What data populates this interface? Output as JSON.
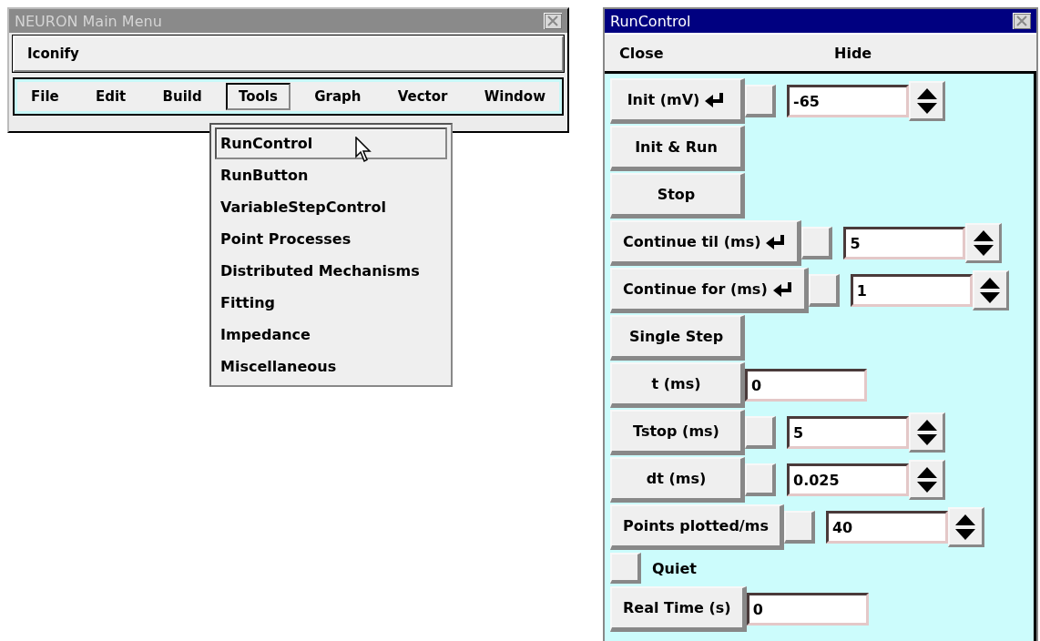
{
  "main_window": {
    "title": "NEURON Main Menu",
    "iconify": "Iconify",
    "menu": [
      {
        "label": "File",
        "selected": false
      },
      {
        "label": "Edit",
        "selected": false
      },
      {
        "label": "Build",
        "selected": false
      },
      {
        "label": "Tools",
        "selected": true
      },
      {
        "label": "Graph",
        "selected": false
      },
      {
        "label": "Vector",
        "selected": false
      },
      {
        "label": "Window",
        "selected": false
      }
    ]
  },
  "tools_menu": {
    "items": [
      {
        "label": "RunControl",
        "selected": true
      },
      {
        "label": "RunButton",
        "selected": false
      },
      {
        "label": "VariableStepControl",
        "selected": false
      },
      {
        "label": "Point Processes",
        "selected": false
      },
      {
        "label": "Distributed Mechanisms",
        "selected": false
      },
      {
        "label": "Fitting",
        "selected": false
      },
      {
        "label": "Impedance",
        "selected": false
      },
      {
        "label": "Miscellaneous",
        "selected": false
      }
    ]
  },
  "run_control": {
    "title": "RunControl",
    "header_buttons": [
      "Close",
      "Hide"
    ],
    "rows": [
      {
        "kind": "spinner",
        "label": "Init (mV)",
        "enter": true,
        "checked": false,
        "value": "-65"
      },
      {
        "kind": "button",
        "label": "Init & Run"
      },
      {
        "kind": "button",
        "label": "Stop"
      },
      {
        "kind": "spinner",
        "label": "Continue til (ms)",
        "enter": true,
        "checked": false,
        "value": "5"
      },
      {
        "kind": "spinner",
        "label": "Continue for (ms)",
        "enter": true,
        "checked": false,
        "value": "1"
      },
      {
        "kind": "button",
        "label": "Single Step"
      },
      {
        "kind": "field",
        "label": "t (ms)",
        "value": "0"
      },
      {
        "kind": "spinner",
        "label": "Tstop (ms)",
        "enter": false,
        "checked": false,
        "value": "5"
      },
      {
        "kind": "spinner",
        "label": "dt (ms)",
        "enter": false,
        "checked": false,
        "value": "0.025"
      },
      {
        "kind": "spinner",
        "label": "Points plotted/ms",
        "enter": false,
        "checked": false,
        "value": "40"
      },
      {
        "kind": "checkbox",
        "label": "Quiet",
        "checked": false
      },
      {
        "kind": "field",
        "label": "Real Time (s)",
        "value": "0"
      }
    ]
  }
}
